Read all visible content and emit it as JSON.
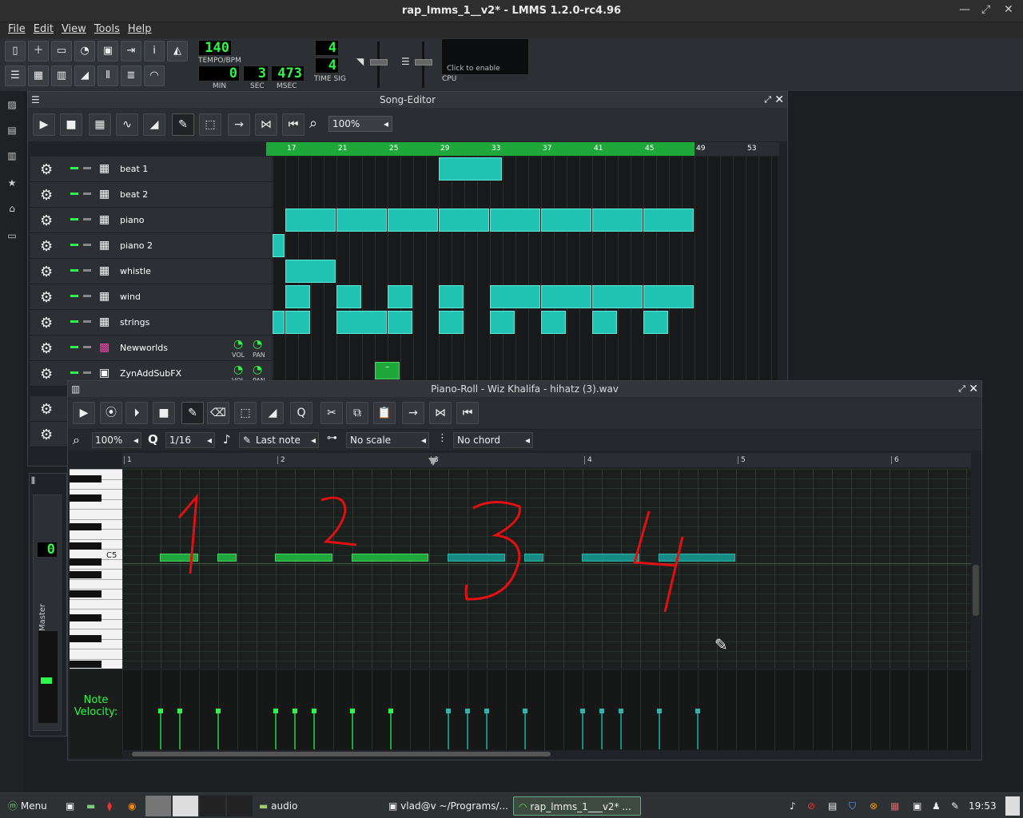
{
  "window": {
    "title": "rap_lmms_1__v2* - LMMS 1.2.0-rc4.96"
  },
  "menu": [
    "File",
    "Edit",
    "View",
    "Tools",
    "Help"
  ],
  "transport": {
    "tempo": "140",
    "tempo_label": "TEMPO/BPM",
    "min": "0",
    "sec": "3",
    "msec": "473",
    "min_label": "MIN",
    "sec_label": "SEC",
    "msec_label": "MSEC",
    "timesig_num": "4",
    "timesig_den": "4",
    "timesig_label": "TIME SIG",
    "cpu_hint": "Click to enable",
    "cpu_label": "CPU"
  },
  "song_editor": {
    "title": "Song-Editor",
    "zoom": "100%",
    "bars": [
      "17",
      "21",
      "25",
      "29",
      "33",
      "37",
      "41",
      "45",
      "49",
      "53"
    ],
    "tracks": [
      {
        "name": "beat 1"
      },
      {
        "name": "beat 2"
      },
      {
        "name": "piano"
      },
      {
        "name": "piano 2"
      },
      {
        "name": "whistle"
      },
      {
        "name": "wind"
      },
      {
        "name": "strings"
      },
      {
        "name": "Newworlds"
      },
      {
        "name": "ZynAddSubFX"
      }
    ],
    "vol_label": "VOL",
    "pan_label": "PAN"
  },
  "piano_roll": {
    "title": "Piano-Roll - Wiz Khalifa - hihatz (3).wav",
    "zoom": "100%",
    "quantize": "1/16",
    "note_length": "Last note",
    "scale": "No scale",
    "chord": "No chord",
    "bars": [
      "1",
      "2",
      "3",
      "4",
      "5",
      "6"
    ],
    "key_label": "C5",
    "velocity_label": "Note Velocity:"
  },
  "mixer": {
    "value": "0",
    "label": "Master"
  },
  "taskbar": {
    "menu": "Menu",
    "tasks": [
      "audio",
      "vlad@v ~/Programs/...",
      "rap_lmms_1___v2* ..."
    ],
    "clock": "19:53"
  },
  "colors": {
    "accent": "#2ef64a",
    "clip": "#21c3b2",
    "note": "#1fa83a"
  }
}
